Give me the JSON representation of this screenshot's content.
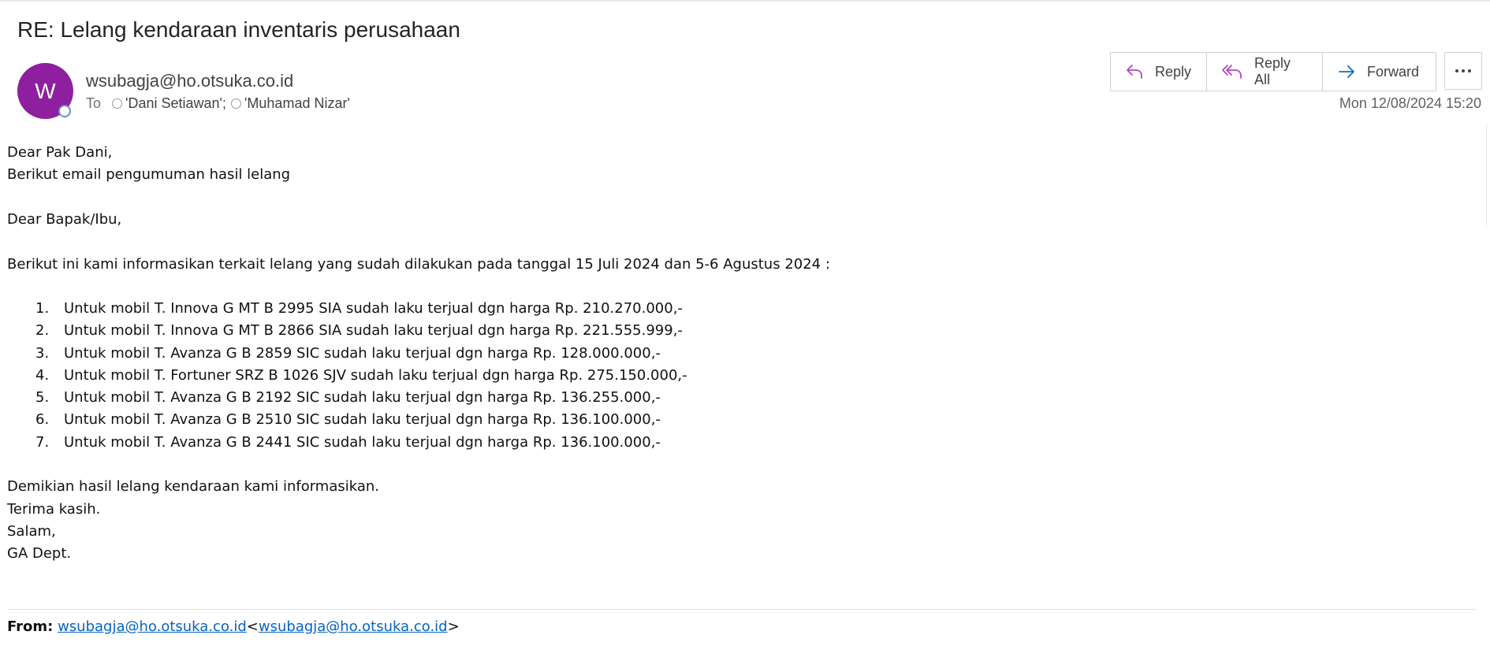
{
  "email": {
    "subject": "RE: Lelang kendaraan inventaris perusahaan",
    "avatar_initial": "W",
    "sender": "wsubagja@ho.otsuka.co.id",
    "to_label": "To",
    "recipients": [
      "'Dani Setiawan'",
      "'Muhamad Nizar'"
    ],
    "recipient_separator": ";",
    "date": "Mon 12/08/2024 15:20"
  },
  "actions": {
    "reply": "Reply",
    "reply_all": "Reply All",
    "forward": "Forward"
  },
  "body": {
    "greeting": "Dear Pak Dani,",
    "intro": "Berikut email pengumuman hasil lelang",
    "salutation": "Dear Bapak/Ibu,",
    "info": "Berikut ini kami informasikan terkait lelang yang sudah dilakukan pada tanggal 15 Juli 2024 dan 5-6 Agustus 2024 :",
    "items": [
      {
        "num": "1.",
        "text": "Untuk mobil T. Innova G MT B 2995 SIA sudah laku terjual dgn harga Rp. 210.270.000,-"
      },
      {
        "num": "2.",
        "text": "Untuk mobil T. Innova G MT B 2866 SIA sudah laku terjual dgn harga Rp. 221.555.999,-"
      },
      {
        "num": "3.",
        "text": "Untuk mobil T. Avanza G B 2859 SIC sudah laku terjual dgn harga Rp. 128.000.000,-"
      },
      {
        "num": "4.",
        "text": "Untuk mobil T. Fortuner SRZ B 1026 SJV sudah laku terjual dgn harga Rp. 275.150.000,-"
      },
      {
        "num": "5.",
        "text": "Untuk mobil T. Avanza G B 2192 SIC sudah laku terjual dgn harga Rp. 136.255.000,-"
      },
      {
        "num": "6.",
        "text": "Untuk mobil T. Avanza G B 2510 SIC sudah laku terjual dgn harga Rp. 136.100.000,-"
      },
      {
        "num": "7.",
        "text": "Untuk mobil T. Avanza G B 2441 SIC sudah laku terjual dgn harga Rp. 136.100.000,-"
      }
    ],
    "closing1": "Demikian hasil lelang kendaraan kami informasikan.",
    "closing2": "Terima kasih.",
    "closing3": "Salam,",
    "closing4": "GA Dept."
  },
  "quoted": {
    "from_label": "From:",
    "from_name": "wsubagja@ho.otsuka.co.id",
    "from_lt": "<",
    "from_email": "wsubagja@ho.otsuka.co.id",
    "from_gt": ">"
  },
  "colors": {
    "avatar": "#8e1f9e",
    "accent_reply": "#b146c2",
    "accent_forward": "#0f6cbd",
    "link": "#0563c1"
  },
  "icons": {
    "reply": "reply-icon",
    "reply_all": "reply-all-icon",
    "forward": "forward-icon",
    "more": "more-icon"
  }
}
